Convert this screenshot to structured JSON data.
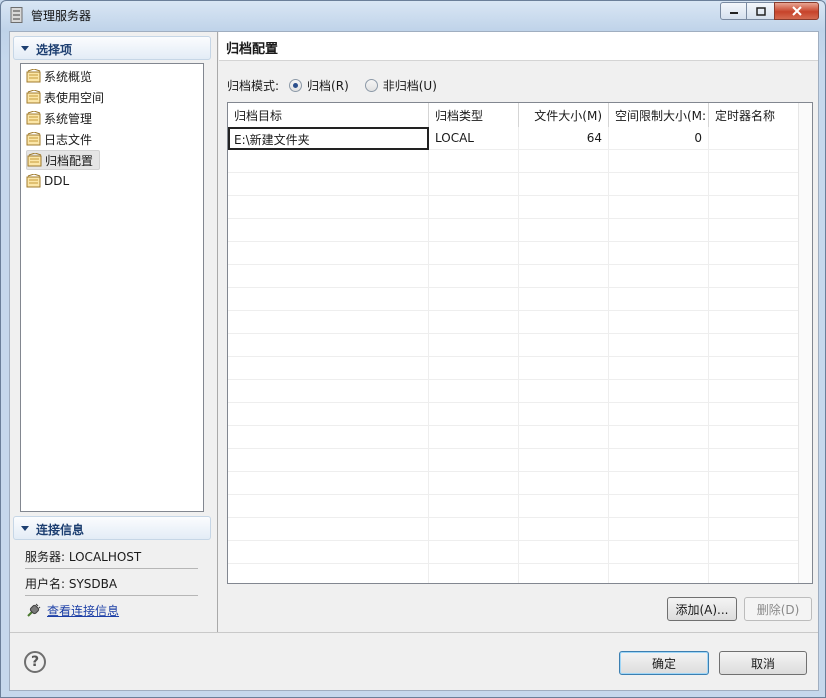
{
  "window": {
    "title": "管理服务器"
  },
  "left": {
    "section_select": "选择项",
    "tree_items": [
      "系统概览",
      "表使用空间",
      "系统管理",
      "日志文件",
      "归档配置",
      "DDL"
    ],
    "selected_index": 4,
    "section_connection": "连接信息",
    "server_label": "服务器: LOCALHOST",
    "user_label": "用户名: SYSDBA",
    "view_connection_link": "查看连接信息"
  },
  "right": {
    "title": "归档配置",
    "mode_label": "归档模式:",
    "radio_archive": "归档(R)",
    "radio_no_archive": "非归档(U)",
    "selected_mode": "archive",
    "columns": [
      "归档目标",
      "归档类型",
      "文件大小(M)",
      "空间限制大小(M:",
      "定时器名称"
    ],
    "rows": [
      {
        "target": "E:\\新建文件夹",
        "type": "LOCAL",
        "file_size": "64",
        "space_limit": "0",
        "timer": ""
      }
    ],
    "add_button": "添加(A)...",
    "delete_button": "删除(D)"
  },
  "footer": {
    "ok_button": "确定",
    "cancel_button": "取消"
  },
  "colors": {
    "accent": "#1d3f71",
    "link": "#1c3fa6",
    "close_button": "#c7432a"
  }
}
